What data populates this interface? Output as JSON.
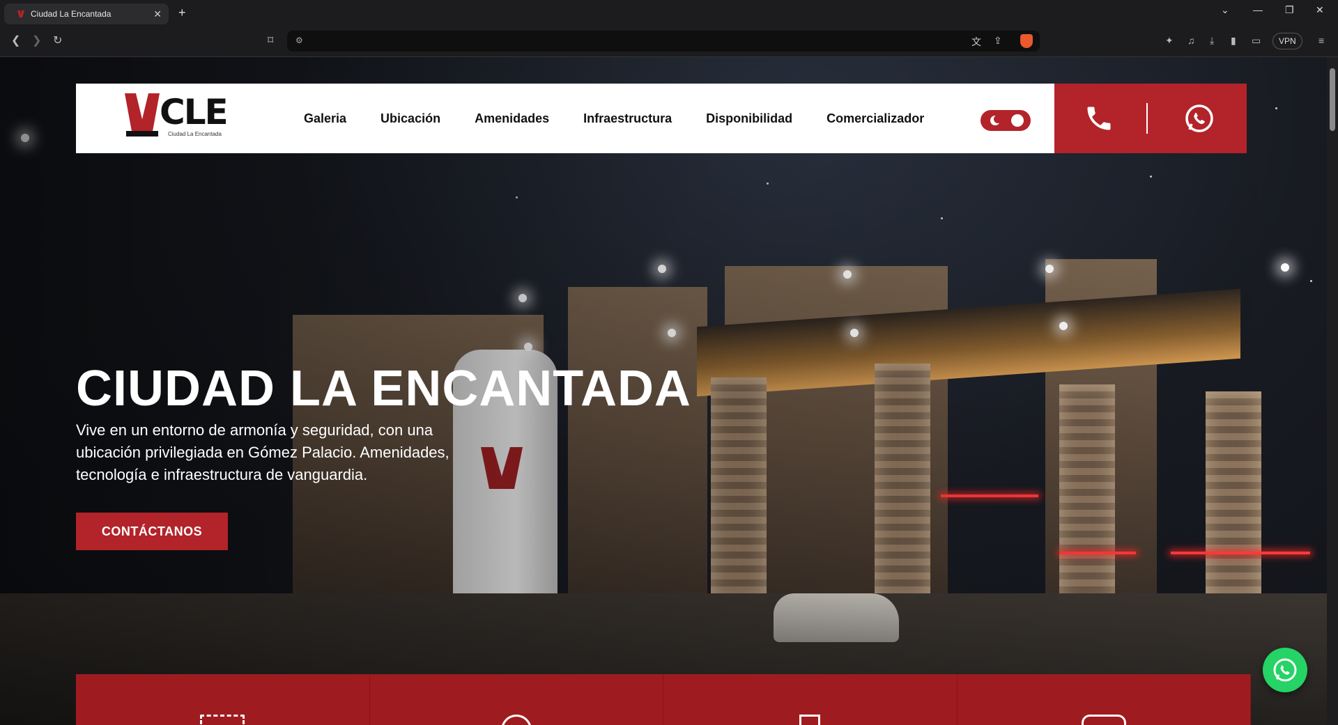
{
  "browser": {
    "tab_title": "Ciudad La Encantada",
    "new_tab": "+",
    "close_tab": "✕",
    "vpn_label": "VPN"
  },
  "header": {
    "logo_letters": "CLE",
    "logo_subtitle": "Ciudad La Encantada",
    "nav": [
      "Galeria",
      "Ubicación",
      "Amenidades",
      "Infraestructura",
      "Disponibilidad",
      "Comercializador"
    ],
    "accent_color": "#b3232a"
  },
  "hero": {
    "title": "CIUDAD LA ENCANTADA",
    "text": "Vive en un entorno de armonía y seguridad, con una ubicación privilegiada en Gómez Palacio. Amenidades, tecnología e infraestructura de vanguardia.",
    "cta_label": "CONTÁCTANOS"
  },
  "icons": {
    "phone": "phone-icon",
    "whatsapp": "whatsapp-icon",
    "theme_toggle": "theme-toggle"
  }
}
